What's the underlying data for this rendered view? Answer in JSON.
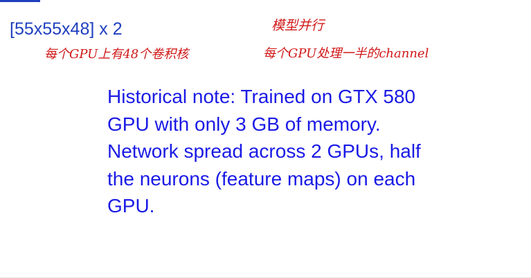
{
  "slide": {
    "heading": "[55x55x48] x 2",
    "annotations": {
      "left": "每个GPU上有48个卷积核",
      "right_title": "模型并行",
      "right_sub": "每个GPU处理一半的channel"
    },
    "historical_note": [
      "Historical note: Trained on GTX 580",
      "GPU with only 3 GB of memory.",
      "Network spread across 2 GPUs, half",
      "the neurons (feature maps) on each",
      "GPU."
    ]
  },
  "colors": {
    "heading_text": "#1f3fbf",
    "note_text": "#1a1ae6",
    "handwriting": "#d01818",
    "background": "#ffffff"
  }
}
